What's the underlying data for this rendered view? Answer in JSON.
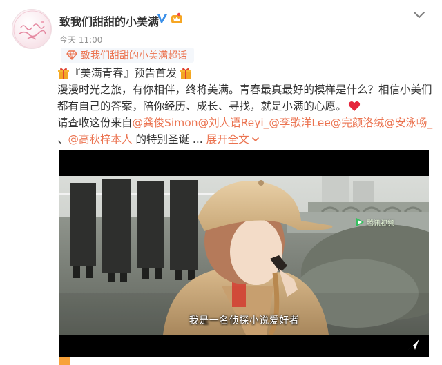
{
  "header": {
    "username": "致我们甜甜的小美满",
    "timestamp": "今天 11:00",
    "verified_icon": "verified-v-icon",
    "vip_icon": "vip-crown-icon",
    "menu_icon": "chevron-down-icon",
    "avatar_text": "致我们甜甜的小美满"
  },
  "supertopic": {
    "icon": "diamond-icon",
    "label": "致我们甜甜的小美满超话"
  },
  "post": {
    "title": "『美满青春』预告首发",
    "title_icon": "gift-icon",
    "line1": "漫漫时光之旅，有你相伴，终将美满。青春最真最好的模样是什么？相信小美们",
    "line2": "都有自己的答案，陪你经历、成长、寻找，就是小满的心愿。",
    "heart_icon": "red-heart-icon",
    "line3_prefix": "请查收这份来自",
    "mentions": [
      "@龚俊Simon",
      "@刘人语Reyi_",
      "@李歌洋Lee",
      "@完颜洛绒",
      "@安泳畅_",
      "@高秋梓本人"
    ],
    "sep1": " ",
    "sep_comma": "、",
    "line4_suffix": " 的特别圣诞 ... ",
    "expand": "展开全文",
    "expand_icon": "chevron-down-icon"
  },
  "video": {
    "watermark": "腾讯视频",
    "subtitle": "我是一名侦探小说爱好者",
    "badge_icon": "video-play-arrow-icon"
  },
  "colors": {
    "accent": "#eb7350",
    "text": "#333333",
    "muted": "#939393",
    "verified": "#3a8fe8",
    "heart": "#e5253b"
  }
}
